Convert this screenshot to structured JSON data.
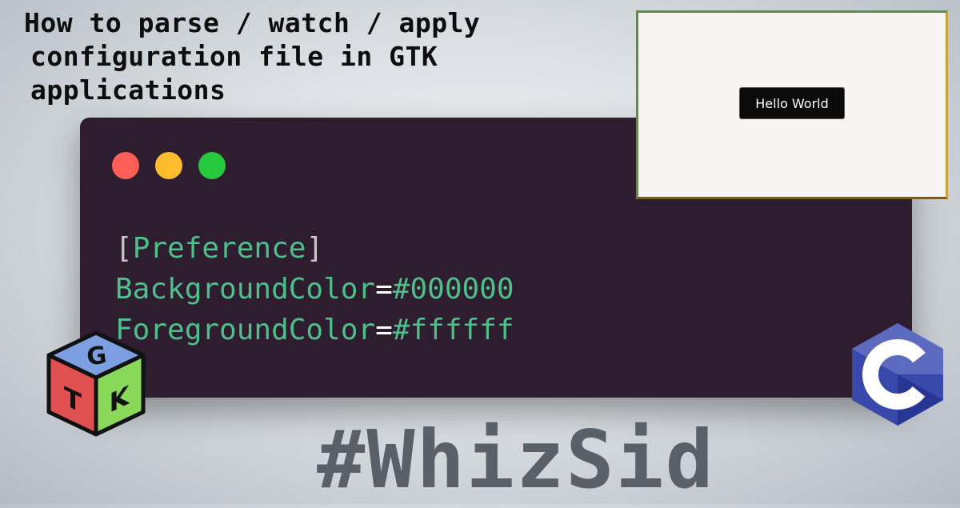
{
  "title": {
    "lines": [
      "How to parse / watch / apply",
      "configuration file in GTK",
      "applications"
    ]
  },
  "editor": {
    "window_controls": [
      "close",
      "minimize",
      "maximize"
    ],
    "code": {
      "section_open": "[",
      "section_name": "Preference",
      "section_close": "]",
      "lines": [
        {
          "key": "BackgroundColor",
          "eq": "=",
          "value": "#000000"
        },
        {
          "key": "ForegroundColor",
          "eq": "=",
          "value": "#ffffff"
        }
      ]
    }
  },
  "preview": {
    "button_label": "Hello World"
  },
  "logos": {
    "gtk": {
      "letters": [
        "G",
        "T",
        "K"
      ],
      "icon": "gtk-logo-icon"
    },
    "c_lang": {
      "letter": "C",
      "icon": "c-language-logo-icon"
    }
  },
  "watermark": "#WhizSid",
  "colors": {
    "editor_bg": "#2e1d2e",
    "code_green": "#4ebf8a",
    "dot_red": "#ff5f56",
    "dot_yellow": "#ffbd2e",
    "dot_green": "#27c93f"
  }
}
